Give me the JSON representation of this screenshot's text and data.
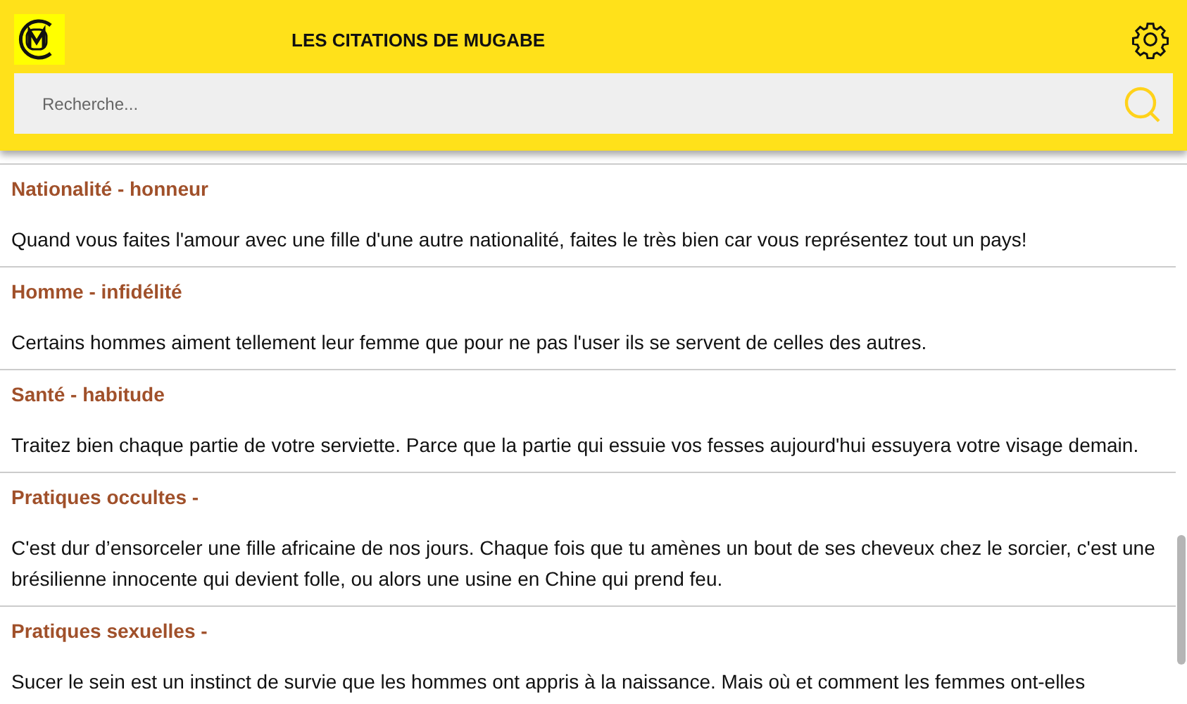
{
  "header": {
    "title": "LES CITATIONS DE MUGABE"
  },
  "search": {
    "placeholder": "Recherche..."
  },
  "quotes": [
    {
      "title": "Nationalité - honneur",
      "text": "Quand vous faites l'amour avec une fille d'une autre nationalité, faites le très bien car vous représentez tout un pays!"
    },
    {
      "title": "Homme - infidélité",
      "text": "Certains hommes aiment tellement leur femme que pour ne pas l'user ils se servent de celles des autres."
    },
    {
      "title": "Santé - habitude",
      "text": "Traitez bien chaque partie de votre serviette. Parce que la partie qui essuie vos fesses aujourd'hui essuyera votre visage demain."
    },
    {
      "title": "Pratiques occultes -",
      "text": "C'est dur d’ensorceler une fille africaine de nos jours. Chaque fois que tu amènes un bout de ses cheveux chez le sorcier, c'est une brésilienne innocente qui devient folle, ou alors une usine en Chine qui prend feu."
    },
    {
      "title": "Pratiques sexuelles -",
      "text": "Sucer le sein est un instinct de survie que les hommes ont appris à la naissance. Mais où et comment les femmes ont-elles"
    }
  ]
}
